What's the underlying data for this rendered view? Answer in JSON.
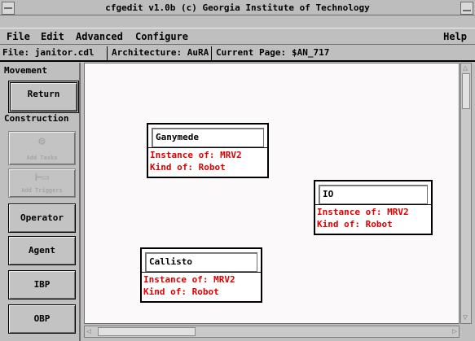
{
  "window": {
    "title": "cfgedit v1.0b  (c) Georgia Institute of Technology"
  },
  "menubar": {
    "file": "File",
    "edit": "Edit",
    "advanced": "Advanced",
    "configure": "Configure",
    "help": "Help"
  },
  "infobar": {
    "file": "File: janitor.cdl",
    "architecture": "Architecture: AuRA",
    "current_page": "Current Page:",
    "page_value": "$AN_717"
  },
  "left_panel": {
    "movement_label": "Movement",
    "return_label": "Return",
    "construction_label": "Construction",
    "add_tasks": "Add Tasks",
    "add_triggers": "Add Triggers",
    "operator": "Operator",
    "agent": "Agent",
    "ibp": "IBP",
    "obp": "OBP"
  },
  "nodes": [
    {
      "name": "Ganymede",
      "instance_of": "Instance of: MRV2",
      "kind_of": "Kind of: Robot"
    },
    {
      "name": "IO",
      "instance_of": "Instance of: MRV2",
      "kind_of": "Kind of: Robot"
    },
    {
      "name": "Callisto",
      "instance_of": "Instance of: MRV2",
      "kind_of": "Kind of: Robot"
    }
  ],
  "icons": {
    "add_tasks": "add-tasks-icon",
    "add_triggers": "add-triggers-icon",
    "scroll_up": "scroll-up-icon",
    "scroll_down": "scroll-down-icon",
    "scroll_left": "scroll-left-icon",
    "scroll_right": "scroll-right-icon",
    "window_menu": "window-menu-icon",
    "window_minimize": "minimize-icon"
  }
}
